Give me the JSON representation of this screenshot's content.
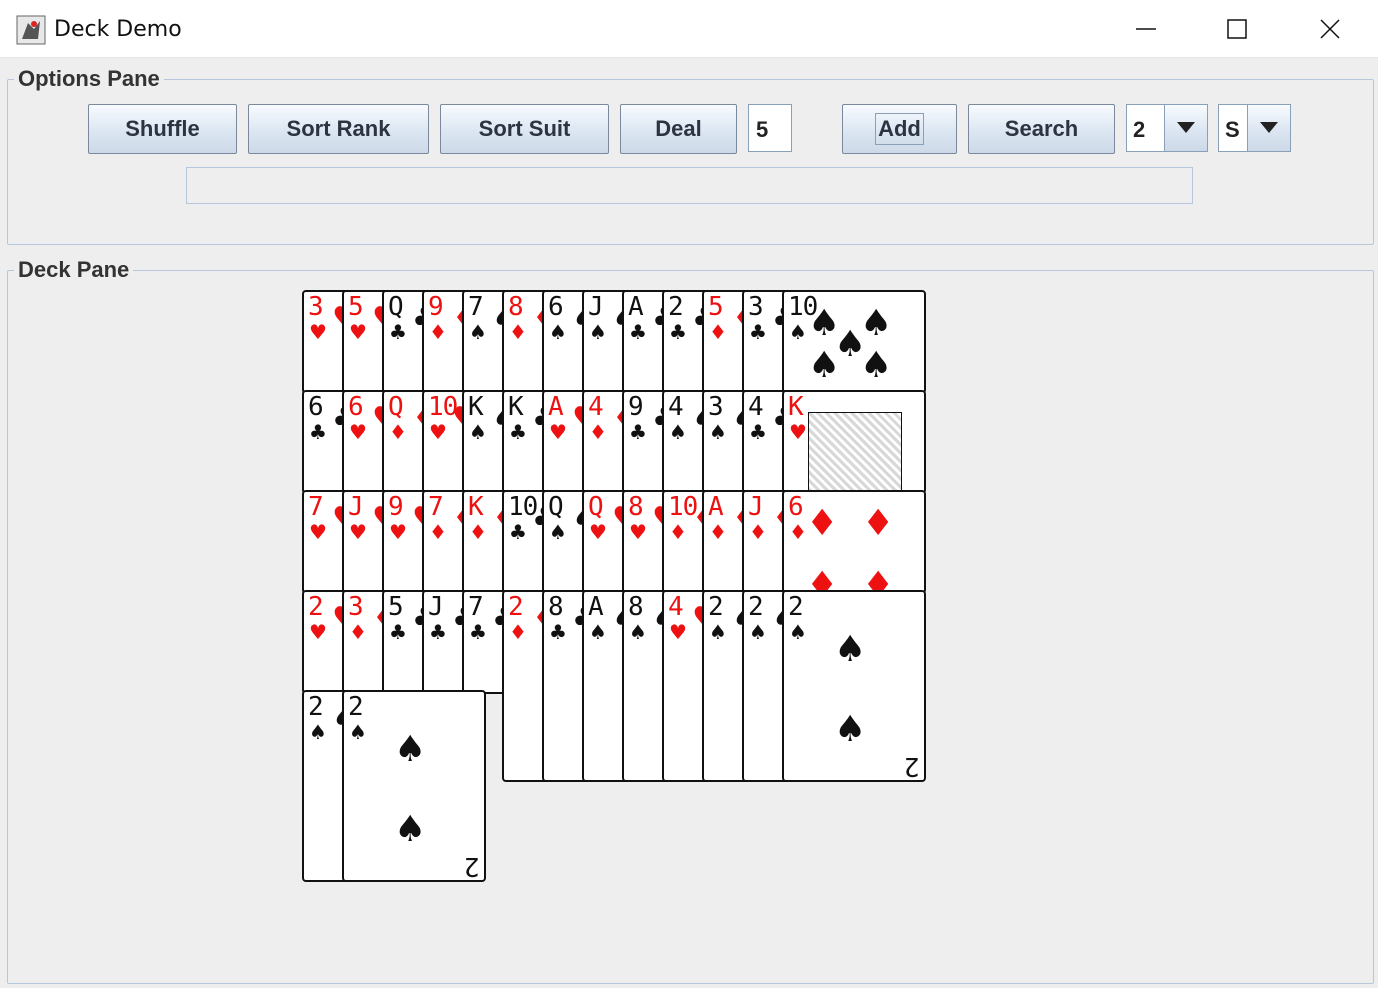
{
  "window": {
    "title": "Deck Demo"
  },
  "options_pane": {
    "legend": "Options Pane",
    "buttons": {
      "shuffle": "Shuffle",
      "sort_rank": "Sort Rank",
      "sort_suit": "Sort Suit",
      "deal": "Deal",
      "add": "Add",
      "search": "Search"
    },
    "deal_count": "5",
    "rank_select": "2",
    "suit_select": "S",
    "result_text": ""
  },
  "deck_pane": {
    "legend": "Deck Pane",
    "rows": [
      [
        {
          "rank": "3",
          "suit": "♥",
          "color": "red"
        },
        {
          "rank": "5",
          "suit": "♥",
          "color": "red"
        },
        {
          "rank": "Q",
          "suit": "♣",
          "color": "black"
        },
        {
          "rank": "9",
          "suit": "♦",
          "color": "red"
        },
        {
          "rank": "7",
          "suit": "♠",
          "color": "black"
        },
        {
          "rank": "8",
          "suit": "♦",
          "color": "red"
        },
        {
          "rank": "6",
          "suit": "♠",
          "color": "black"
        },
        {
          "rank": "J",
          "suit": "♠",
          "color": "black"
        },
        {
          "rank": "A",
          "suit": "♣",
          "color": "black"
        },
        {
          "rank": "2",
          "suit": "♣",
          "color": "black"
        },
        {
          "rank": "5",
          "suit": "♦",
          "color": "red"
        },
        {
          "rank": "3",
          "suit": "♣",
          "color": "black"
        },
        {
          "rank": "10",
          "suit": "♠",
          "color": "black"
        }
      ],
      [
        {
          "rank": "6",
          "suit": "♣",
          "color": "black"
        },
        {
          "rank": "6",
          "suit": "♥",
          "color": "red"
        },
        {
          "rank": "Q",
          "suit": "♦",
          "color": "red"
        },
        {
          "rank": "10",
          "suit": "♥",
          "color": "red"
        },
        {
          "rank": "K",
          "suit": "♠",
          "color": "black"
        },
        {
          "rank": "K",
          "suit": "♣",
          "color": "black"
        },
        {
          "rank": "A",
          "suit": "♥",
          "color": "red"
        },
        {
          "rank": "4",
          "suit": "♦",
          "color": "red"
        },
        {
          "rank": "9",
          "suit": "♣",
          "color": "black"
        },
        {
          "rank": "4",
          "suit": "♠",
          "color": "black"
        },
        {
          "rank": "3",
          "suit": "♠",
          "color": "black"
        },
        {
          "rank": "4",
          "suit": "♣",
          "color": "black"
        },
        {
          "rank": "K",
          "suit": "♥",
          "color": "red"
        }
      ],
      [
        {
          "rank": "7",
          "suit": "♥",
          "color": "red"
        },
        {
          "rank": "J",
          "suit": "♥",
          "color": "red"
        },
        {
          "rank": "9",
          "suit": "♥",
          "color": "red"
        },
        {
          "rank": "7",
          "suit": "♦",
          "color": "red"
        },
        {
          "rank": "K",
          "suit": "♦",
          "color": "red"
        },
        {
          "rank": "10",
          "suit": "♣",
          "color": "black"
        },
        {
          "rank": "Q",
          "suit": "♠",
          "color": "black"
        },
        {
          "rank": "Q",
          "suit": "♥",
          "color": "red"
        },
        {
          "rank": "8",
          "suit": "♥",
          "color": "red"
        },
        {
          "rank": "10",
          "suit": "♦",
          "color": "red"
        },
        {
          "rank": "A",
          "suit": "♦",
          "color": "red"
        },
        {
          "rank": "J",
          "suit": "♦",
          "color": "red"
        },
        {
          "rank": "6",
          "suit": "♦",
          "color": "red"
        }
      ],
      [
        {
          "rank": "2",
          "suit": "♥",
          "color": "red"
        },
        {
          "rank": "3",
          "suit": "♦",
          "color": "red"
        },
        {
          "rank": "5",
          "suit": "♣",
          "color": "black"
        },
        {
          "rank": "J",
          "suit": "♣",
          "color": "black"
        },
        {
          "rank": "7",
          "suit": "♣",
          "color": "black"
        },
        {
          "rank": "2",
          "suit": "♦",
          "color": "red"
        },
        {
          "rank": "8",
          "suit": "♣",
          "color": "black"
        },
        {
          "rank": "A",
          "suit": "♠",
          "color": "black"
        },
        {
          "rank": "8",
          "suit": "♠",
          "color": "black"
        },
        {
          "rank": "4",
          "suit": "♥",
          "color": "red"
        },
        {
          "rank": "2",
          "suit": "♠",
          "color": "black"
        },
        {
          "rank": "2",
          "suit": "♠",
          "color": "black"
        },
        {
          "rank": "2",
          "suit": "♠",
          "color": "black"
        }
      ],
      [
        {
          "rank": "2",
          "suit": "♠",
          "color": "black"
        },
        {
          "rank": "2",
          "suit": "♠",
          "color": "black"
        }
      ]
    ]
  }
}
